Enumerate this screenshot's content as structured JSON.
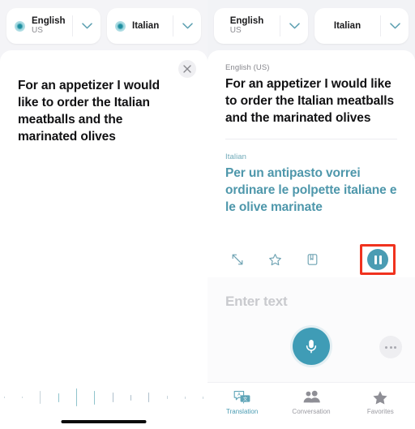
{
  "theme": {
    "accent": "#4b9cb3",
    "accent_text": "#4e97ab",
    "highlight_box": "#f0321e",
    "page_bg": "#f2f3f6",
    "card_bg": "#ffffff",
    "muted_text": "#86868c"
  },
  "left_panel": {
    "source_lang": {
      "name": "English",
      "region": "US",
      "icon": "recording-dot-icon",
      "chevron": "chevron-down-icon"
    },
    "target_lang": {
      "name": "Italian",
      "region": "",
      "icon": "recording-dot-icon",
      "chevron": "chevron-down-icon"
    },
    "close_icon": "close-icon",
    "listening_text": "For an appetizer I would like to order the Italian meatballs and the marinated olives",
    "waveform": {
      "name": "audio-waveform",
      "heights": [
        2,
        2,
        2,
        3,
        2,
        2,
        3,
        2,
        2,
        3,
        2,
        4,
        2,
        3,
        2,
        2,
        3,
        4,
        3,
        2,
        3,
        2,
        4,
        3,
        2,
        3,
        2,
        5,
        3,
        2,
        4,
        3,
        2,
        4,
        6,
        5,
        4,
        3,
        6,
        5,
        4,
        3,
        5,
        8,
        6,
        4,
        14,
        16,
        13,
        6,
        4,
        9,
        6,
        4,
        8,
        5,
        3,
        6,
        10,
        7,
        5,
        9,
        14,
        8,
        6,
        12,
        10,
        7,
        5,
        11,
        9,
        15,
        20,
        13,
        9,
        18,
        26,
        22,
        16,
        11,
        19,
        24,
        17,
        12,
        20,
        27,
        21,
        14,
        10,
        16,
        22,
        18,
        13,
        20,
        25,
        19,
        14,
        23,
        28,
        21,
        15,
        11,
        17,
        13,
        9,
        15,
        20,
        16,
        12,
        18,
        23,
        17,
        13,
        10,
        16,
        21,
        15,
        11,
        17,
        22,
        16,
        12,
        9,
        14,
        19,
        15,
        11,
        17,
        13,
        9,
        16,
        21,
        17,
        12,
        9,
        14,
        11,
        8,
        13,
        18,
        14,
        10,
        7,
        12,
        16,
        12,
        9,
        14,
        11,
        8,
        12,
        16,
        12,
        9,
        7,
        11,
        15,
        11,
        8,
        12,
        9,
        7,
        11,
        14,
        10,
        8,
        6,
        10,
        13,
        9,
        7,
        11,
        8,
        6,
        9,
        12,
        9,
        7,
        5,
        8,
        11,
        8,
        6,
        9,
        7,
        5,
        8,
        10,
        7,
        5,
        4,
        7,
        9,
        6,
        5,
        7,
        5,
        4,
        6,
        8,
        6,
        4,
        3,
        5,
        7,
        5,
        4,
        6,
        4,
        3,
        5,
        6,
        4,
        3,
        2,
        4,
        5,
        4,
        3,
        4,
        3,
        2,
        3,
        4,
        3,
        2,
        2,
        3,
        4,
        3,
        2,
        3,
        2,
        2,
        3,
        2,
        2,
        2,
        2,
        3,
        2,
        2,
        2,
        2,
        2
      ]
    },
    "home_indicator": "home-indicator"
  },
  "right_panel": {
    "source_lang": {
      "name": "English",
      "region": "US",
      "chevron": "chevron-down-icon"
    },
    "target_lang": {
      "name": "Italian",
      "region": "",
      "chevron": "chevron-down-icon"
    },
    "result": {
      "source_label": "English (US)",
      "source_text": "For an appetizer I would like to order the Italian meatballs and the marinated olives",
      "target_label": "Italian",
      "target_text": "Per un antipasto vorrei ordinare le polpette italiane e le olive marinate"
    },
    "actions": {
      "fullscreen_icon": "expand-arrows-icon",
      "favorite_icon": "star-outline-icon",
      "dictionary_icon": "book-icon",
      "play_pause_icon": "pause-icon",
      "play_pause_highlighted": true
    },
    "input": {
      "placeholder": "Enter text",
      "mic_icon": "microphone-icon",
      "more_icon": "more-ellipsis-icon"
    },
    "tabs": [
      {
        "label": "Translation",
        "icon": "translation-icon",
        "active": true
      },
      {
        "label": "Conversation",
        "icon": "conversation-icon",
        "active": false
      },
      {
        "label": "Favorites",
        "icon": "star-filled-icon",
        "active": false
      }
    ]
  }
}
